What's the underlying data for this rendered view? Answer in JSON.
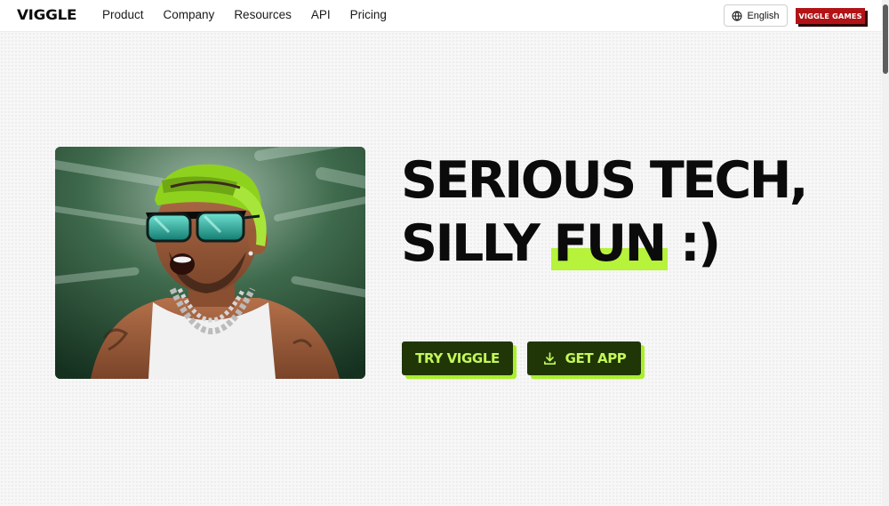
{
  "header": {
    "logo": "VIGGLE",
    "nav_items": [
      "Product",
      "Company",
      "Resources",
      "API",
      "Pricing"
    ],
    "language_label": "English",
    "games_label": "VIGGLE GAMES"
  },
  "hero": {
    "headline_line1": "SERIOUS TECH,",
    "headline_line2_start": "SILLY ",
    "headline_highlight": "FUN",
    "headline_line2_end": " :)",
    "try_button": "TRY VIGGLE",
    "app_button": "GET APP"
  },
  "colors": {
    "accent_green": "#b6f33a",
    "button_dark": "#203607",
    "games_red": "#b21316"
  },
  "icons": {
    "language": "globe-icon",
    "app_button": "download-icon"
  }
}
